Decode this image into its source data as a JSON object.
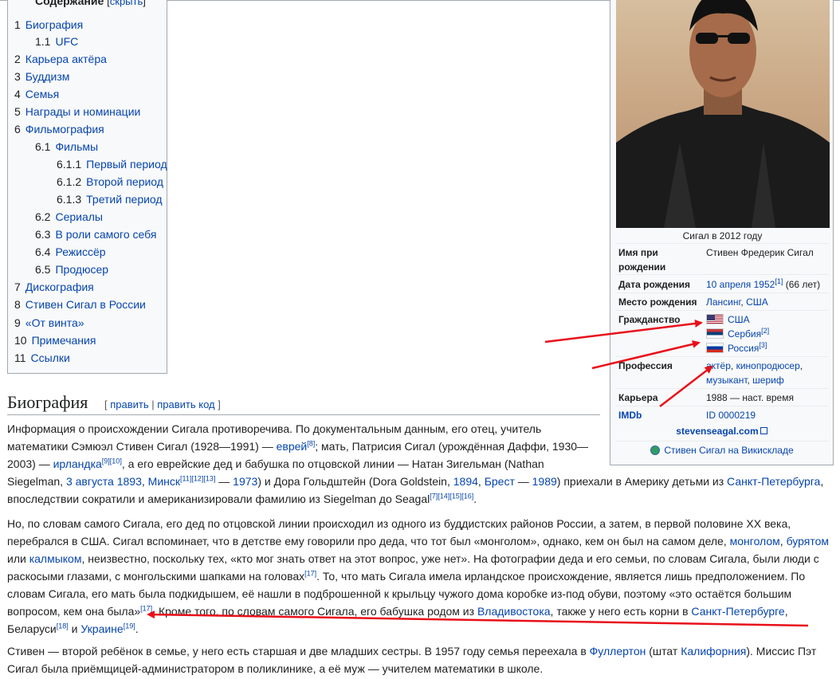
{
  "toc": {
    "title": "Содержание",
    "hide_prefix": "[",
    "hide_label": "скрыть",
    "hide_suffix": "]",
    "items": [
      {
        "num": "1",
        "label": "Биография"
      },
      {
        "num": "1.1",
        "label": "UFC"
      },
      {
        "num": "2",
        "label": "Карьера актёра"
      },
      {
        "num": "3",
        "label": "Буддизм"
      },
      {
        "num": "4",
        "label": "Семья"
      },
      {
        "num": "5",
        "label": "Награды и номинации"
      },
      {
        "num": "6",
        "label": "Фильмография"
      },
      {
        "num": "6.1",
        "label": "Фильмы"
      },
      {
        "num": "6.1.1",
        "label": "Первый период"
      },
      {
        "num": "6.1.2",
        "label": "Второй период"
      },
      {
        "num": "6.1.3",
        "label": "Третий период"
      },
      {
        "num": "6.2",
        "label": "Сериалы"
      },
      {
        "num": "6.3",
        "label": "В роли самого себя"
      },
      {
        "num": "6.4",
        "label": "Режиссёр"
      },
      {
        "num": "6.5",
        "label": "Продюсер"
      },
      {
        "num": "7",
        "label": "Дискография"
      },
      {
        "num": "8",
        "label": "Стивен Сигал в России"
      },
      {
        "num": "9",
        "label": "«От винта»"
      },
      {
        "num": "10",
        "label": "Примечания"
      },
      {
        "num": "11",
        "label": "Ссылки"
      }
    ]
  },
  "section": {
    "heading": "Биография",
    "edit_open": "[ ",
    "edit": "править",
    "edit_sep": " | ",
    "edit_code": "править код",
    "edit_close": " ]"
  },
  "para1": {
    "l1a": "Информация о происхождении Сигала противоречива. По документальным данным, его отец, учитель",
    "l2a": "математики Сэмюэл Стивен Сигал (1928—1991) — ",
    "l2b": "еврей",
    "l2c": "[8]",
    "l2d": "; мать, Патрисия Сигал (урождённая Даффи, 1930—",
    "l3a": "2003) — ",
    "l3b": "ирландка",
    "l3c": "[9][10]",
    "l3d": ", а его еврейские дед и бабушка по отцовской линии — Натан Зигельман (Nathan",
    "l4a": "Siegelman, ",
    "l4b": "3 августа",
    "l4c": "1893",
    "l4d": "Минск",
    "l4e": "[11][12][13]",
    "l4f": "1973",
    "l4g": ") и Дора Гольдштейн (Dora Goldstein, ",
    "l4h": "1894",
    "l4i": "Брест",
    "l4j": "1989",
    "l4k": ") приехали в Америку детьми из ",
    "l4l": "Санкт-Петербурга",
    "l5a": "впоследствии сократили и американизировали фамилию из Siegelman до Seagal",
    "l5b": "[7][14][15][16]"
  },
  "para2": {
    "l1": "Но, по словам самого Сигала, его дед по отцовской линии происходил из одного из буддистских районов России, а затем, в первой половине XX века,",
    "l2a": "перебрался в США. Сигал вспоминает, что в детстве ему говорили про деда, что тот был «монголом», однако, кем он был на самом деле, ",
    "l2b": "монголом",
    "l2c": "бурятом",
    "l3a": "или ",
    "l3b": "калмыком",
    "l3c": ", неизвестно, поскольку тех, «кто мог знать ответ на этот вопрос, уже нет». На фотографии деда и его семьи, по словам Сигала, были люди с",
    "l4a": "раскосыми глазами, с монгольскими шапками на головах",
    "l4b": "[17]",
    "l4c": ". То, что мать Сигала имела ирландское происхождение, является лишь предположением. По",
    "l5": "словам Сигала, его мать была подкидышем, её нашли в подброшенной к крыльцу чужого дома коробке из-под обуви, поэтому «это остаётся большим",
    "l6a": "вопросом, кем она была»",
    "l6b": "[17]",
    "l6c": ". Кроме того, по словам самого Сигала, его бабушка родом из ",
    "l6d": "Владивостока",
    "l6e": ", также у него есть корни в ",
    "l6f": "Санкт-Петербурге",
    "l7a": "Беларуси",
    "l7b": "[18]",
    "l7c": " и ",
    "l7d": "Украине",
    "l7e": "[19]"
  },
  "para3": {
    "l1a": "Стивен — второй ребёнок в семье, у него есть старшая и две младших сестры. В 1957 году семья переехала в ",
    "l1b": "Фуллертон",
    "l1c": " (штат ",
    "l1d": "Калифорния",
    "l1e": "). Миссис Пэт",
    "l2": "Сигал была приёмщицей-администратором в поликлинике, а её муж — учителем математики в школе."
  },
  "infobox": {
    "caption": "Сигал в 2012 году",
    "rows": {
      "birth_name_k": "Имя при рождении",
      "birth_name_v": "Стивен Фредерик Сигал",
      "dob_k": "Дата рождения",
      "dob_link": "10 апреля 1952",
      "dob_ref": "[1]",
      "dob_age": " (66 лет)",
      "pob_k": "Место рождения",
      "pob_city": "Лансинг",
      "pob_country": "США",
      "cit_k": "Гражданство",
      "cit_us": "США",
      "cit_rs": "Сербия",
      "cit_rs_ref": "[2]",
      "cit_ru": "Россия",
      "cit_ru_ref": "[3]",
      "prof_k": "Профессия",
      "prof_1": "актёр",
      "prof_2": "кинопродюсер",
      "prof_3": "музыкант",
      "prof_4": "шериф",
      "career_k": "Карьера",
      "career_v": "1988 — наст. время",
      "imdb_k": "IMDb",
      "imdb_v": "ID 0000219"
    },
    "site": "stevenseagal.com",
    "commons": "Стивен Сигал на Викискладе"
  },
  "colors": {
    "link": "#0645ad",
    "arrow": "#e8101a",
    "box_bg": "#f8f9fa",
    "border": "#a2a9b1"
  }
}
